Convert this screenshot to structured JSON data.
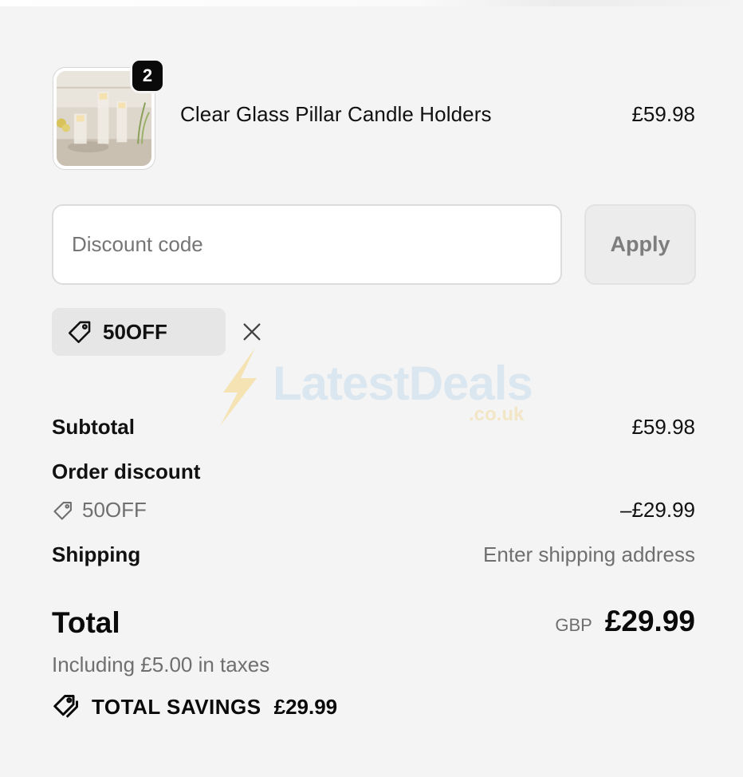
{
  "product": {
    "quantity": "2",
    "name": "Clear Glass Pillar Candle Holders",
    "price": "£59.98",
    "image_icon": "candle-holders-thumbnail"
  },
  "discount": {
    "placeholder": "Discount code",
    "value": "",
    "apply_label": "Apply",
    "applied_code": "50OFF"
  },
  "watermark": {
    "name": "LatestDeals",
    "domain": ".co.uk"
  },
  "summary": {
    "subtotal_label": "Subtotal",
    "subtotal_value": "£59.98",
    "order_discount_label": "Order discount",
    "order_discount_code": "50OFF",
    "order_discount_value": "–£29.99",
    "shipping_label": "Shipping",
    "shipping_value": "Enter shipping address"
  },
  "total": {
    "label": "Total",
    "currency": "GBP",
    "amount": "£29.99",
    "taxes_note": "Including £5.00 in taxes"
  },
  "savings": {
    "label": "TOTAL SAVINGS",
    "amount": "£29.99"
  },
  "colors": {
    "background": "#f4f4f4",
    "text": "#111111",
    "muted": "#6f6f6f",
    "badge": "#0a0a0a",
    "chip": "#e6e6e6",
    "watermark_blue": "#dbe7f0",
    "watermark_gold": "#f3e6c6"
  }
}
